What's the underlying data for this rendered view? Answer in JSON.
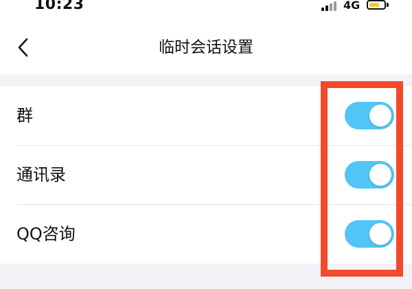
{
  "status_bar": {
    "time": "10:23",
    "network": "4G",
    "signal_icon": "signal-bars-icon",
    "battery_icon": "battery-icon"
  },
  "nav": {
    "title": "临时会话设置",
    "back_icon": "chevron-left-icon"
  },
  "settings": {
    "items": [
      {
        "label": "群",
        "enabled": true
      },
      {
        "label": "通讯录",
        "enabled": true
      },
      {
        "label": "QQ咨询",
        "enabled": true
      }
    ]
  },
  "colors": {
    "toggle_on": "#52c4f5",
    "highlight_border": "#f24a2b",
    "battery_fill": "#f5c93a",
    "background": "#f2f2f7"
  }
}
